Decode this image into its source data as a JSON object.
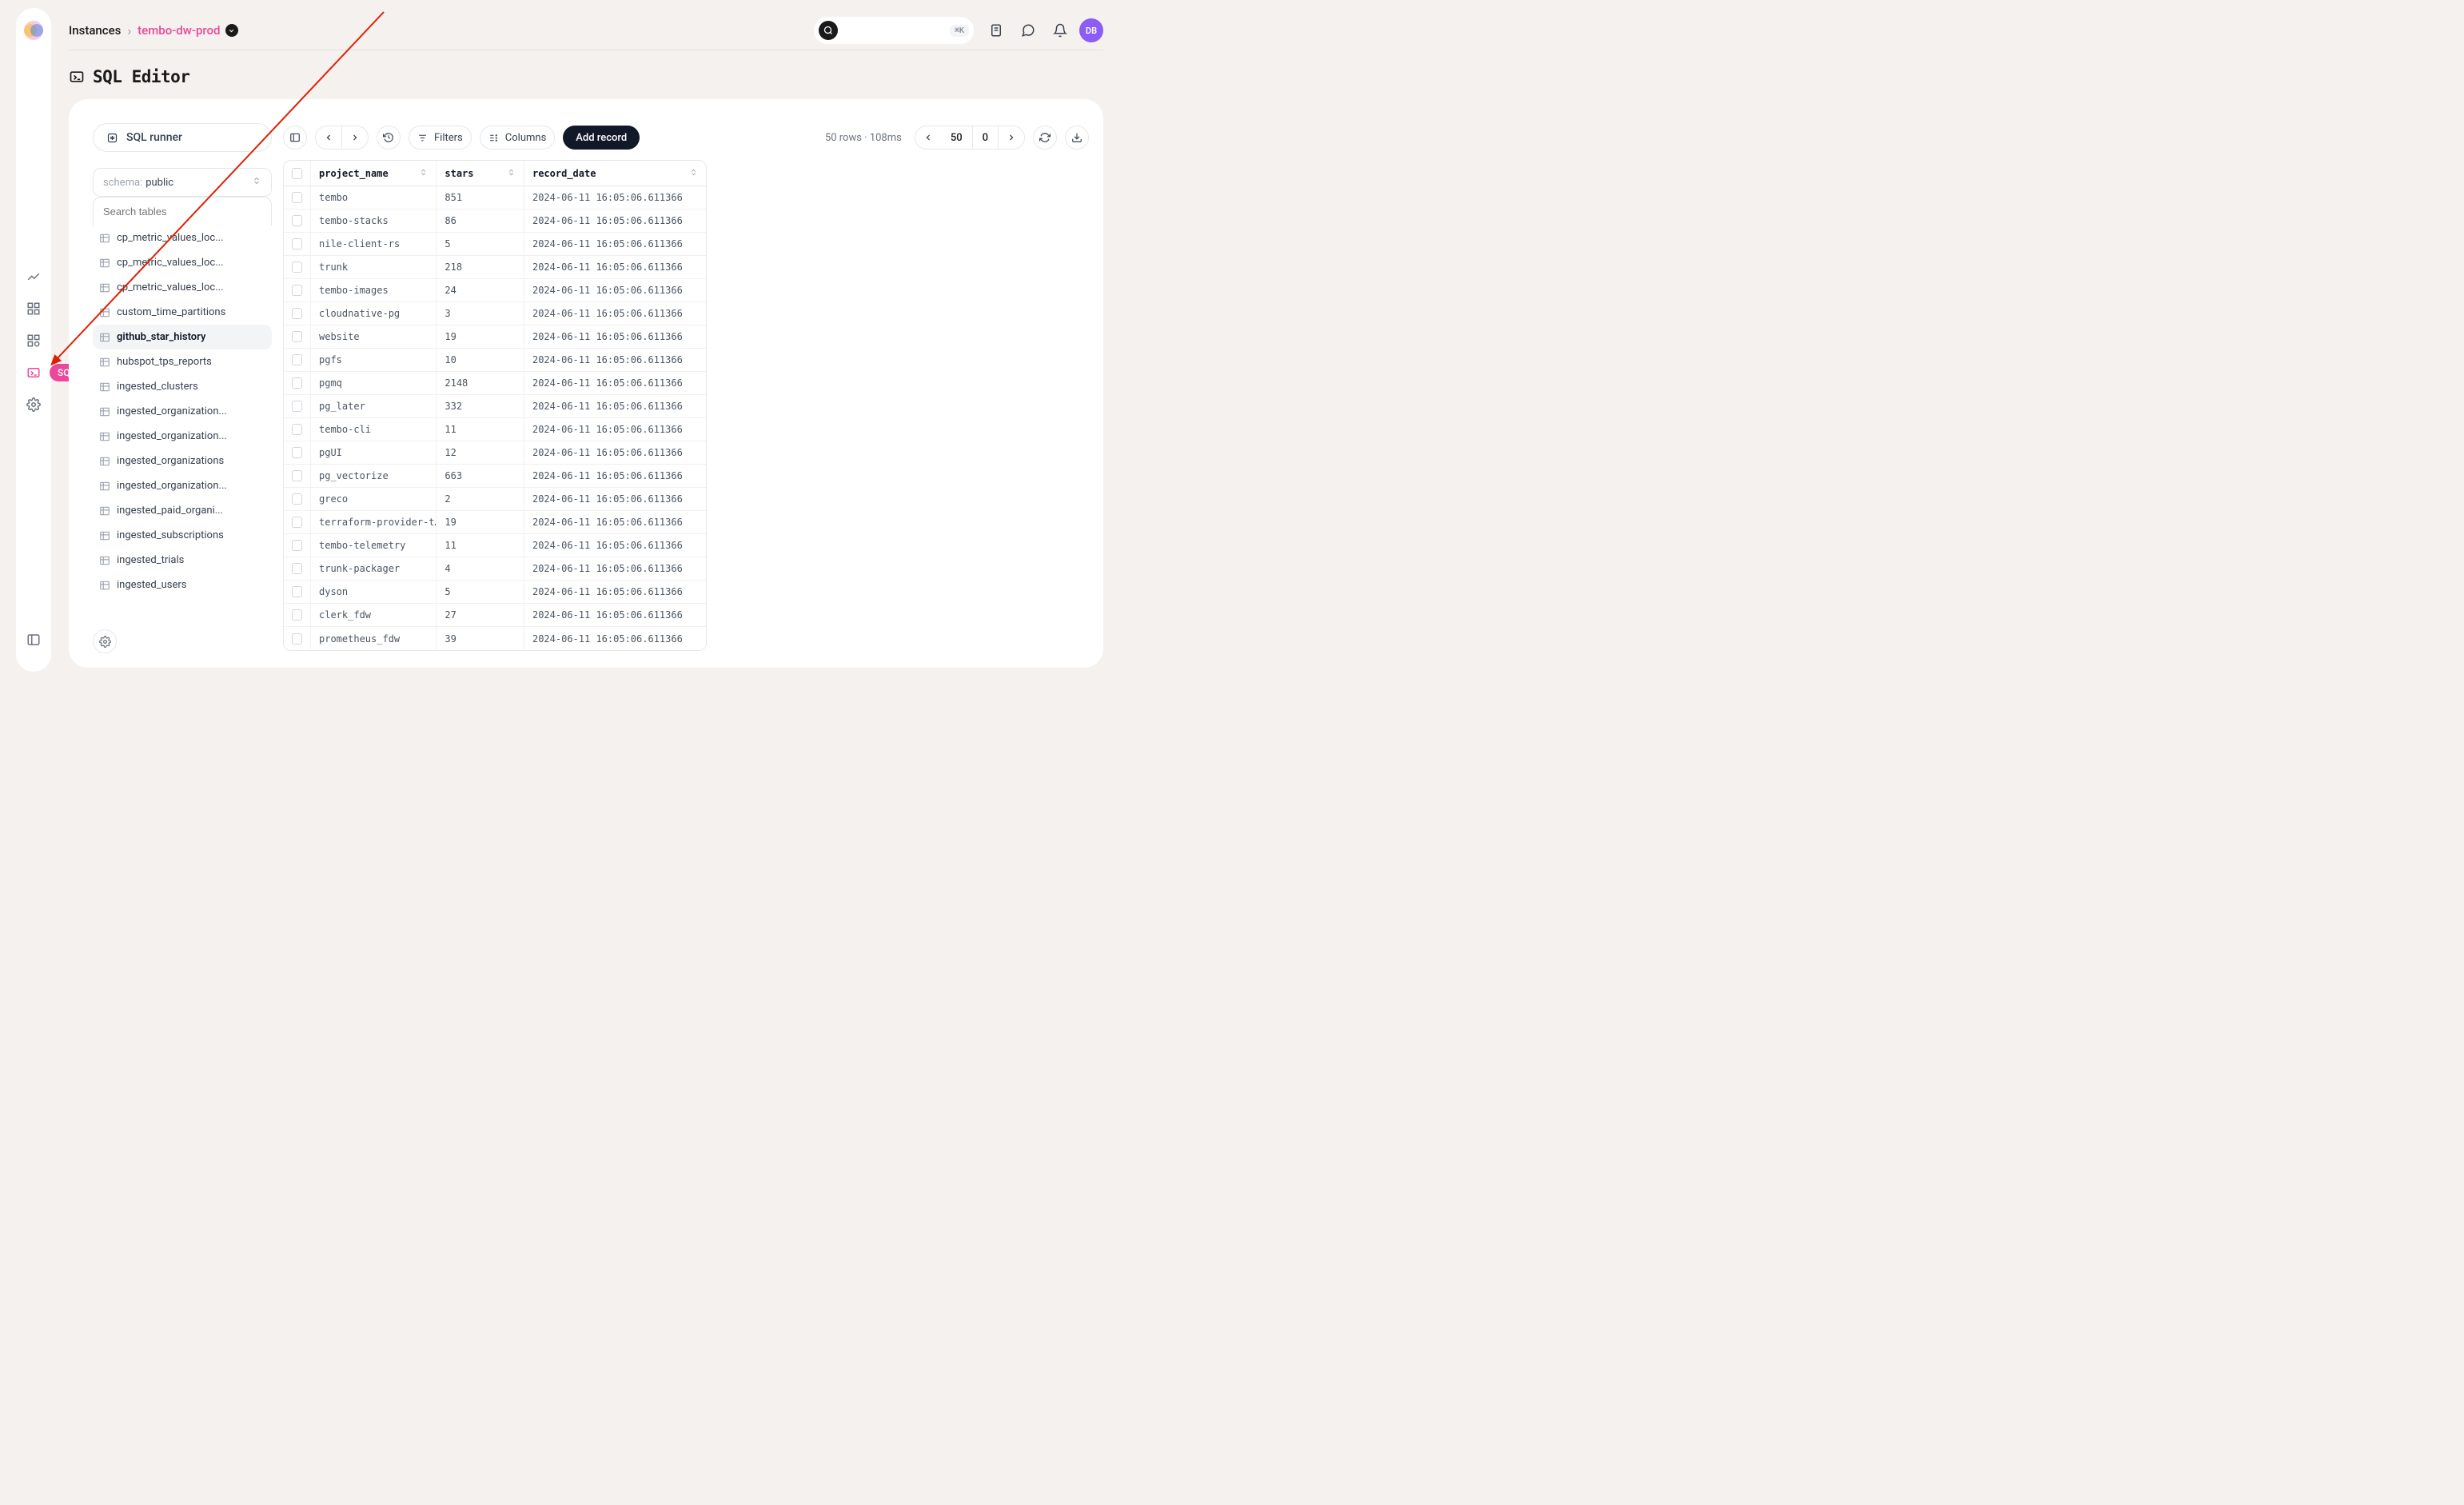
{
  "breadcrumb": {
    "root": "Instances",
    "current": "tembo-dw-prod"
  },
  "search": {
    "shortcut": "⌘K"
  },
  "avatar": "DB",
  "page_title": "SQL Editor",
  "sidebar": {
    "sql_runner": "SQL runner",
    "schema_label": "schema:",
    "schema_value": "public",
    "search_placeholder": "Search tables",
    "tables": [
      {
        "name": "cp_metric_values_loc...",
        "active": false
      },
      {
        "name": "cp_metric_values_loc...",
        "active": false
      },
      {
        "name": "cp_metric_values_loc...",
        "active": false
      },
      {
        "name": "custom_time_partitions",
        "active": false
      },
      {
        "name": "github_star_history",
        "active": true
      },
      {
        "name": "hubspot_tps_reports",
        "active": false
      },
      {
        "name": "ingested_clusters",
        "active": false
      },
      {
        "name": "ingested_organization...",
        "active": false
      },
      {
        "name": "ingested_organization...",
        "active": false
      },
      {
        "name": "ingested_organizations",
        "active": false
      },
      {
        "name": "ingested_organization...",
        "active": false
      },
      {
        "name": "ingested_paid_organi...",
        "active": false
      },
      {
        "name": "ingested_subscriptions",
        "active": false
      },
      {
        "name": "ingested_trials",
        "active": false
      },
      {
        "name": "ingested_users",
        "active": false
      }
    ]
  },
  "toolbar": {
    "filters": "Filters",
    "columns": "Columns",
    "add_record": "Add record",
    "rows_info": "50 rows · 108ms",
    "page_size": "50",
    "offset": "0"
  },
  "table": {
    "columns": [
      "project_name",
      "stars",
      "record_date"
    ],
    "rows": [
      {
        "project_name": "tembo",
        "stars": "851",
        "record_date": "2024-06-11 16:05:06.611366"
      },
      {
        "project_name": "tembo-stacks",
        "stars": "86",
        "record_date": "2024-06-11 16:05:06.611366"
      },
      {
        "project_name": "nile-client-rs",
        "stars": "5",
        "record_date": "2024-06-11 16:05:06.611366"
      },
      {
        "project_name": "trunk",
        "stars": "218",
        "record_date": "2024-06-11 16:05:06.611366"
      },
      {
        "project_name": "tembo-images",
        "stars": "24",
        "record_date": "2024-06-11 16:05:06.611366"
      },
      {
        "project_name": "cloudnative-pg",
        "stars": "3",
        "record_date": "2024-06-11 16:05:06.611366"
      },
      {
        "project_name": "website",
        "stars": "19",
        "record_date": "2024-06-11 16:05:06.611366"
      },
      {
        "project_name": "pgfs",
        "stars": "10",
        "record_date": "2024-06-11 16:05:06.611366"
      },
      {
        "project_name": "pgmq",
        "stars": "2148",
        "record_date": "2024-06-11 16:05:06.611366"
      },
      {
        "project_name": "pg_later",
        "stars": "332",
        "record_date": "2024-06-11 16:05:06.611366"
      },
      {
        "project_name": "tembo-cli",
        "stars": "11",
        "record_date": "2024-06-11 16:05:06.611366"
      },
      {
        "project_name": "pgUI",
        "stars": "12",
        "record_date": "2024-06-11 16:05:06.611366"
      },
      {
        "project_name": "pg_vectorize",
        "stars": "663",
        "record_date": "2024-06-11 16:05:06.611366"
      },
      {
        "project_name": "greco",
        "stars": "2",
        "record_date": "2024-06-11 16:05:06.611366"
      },
      {
        "project_name": "terraform-provider-t…",
        "stars": "19",
        "record_date": "2024-06-11 16:05:06.611366"
      },
      {
        "project_name": "tembo-telemetry",
        "stars": "11",
        "record_date": "2024-06-11 16:05:06.611366"
      },
      {
        "project_name": "trunk-packager",
        "stars": "4",
        "record_date": "2024-06-11 16:05:06.611366"
      },
      {
        "project_name": "dyson",
        "stars": "5",
        "record_date": "2024-06-11 16:05:06.611366"
      },
      {
        "project_name": "clerk_fdw",
        "stars": "27",
        "record_date": "2024-06-11 16:05:06.611366"
      },
      {
        "project_name": "prometheus_fdw",
        "stars": "39",
        "record_date": "2024-06-11 16:05:06.611366"
      }
    ]
  },
  "rail_tooltip": "SQL Editor"
}
